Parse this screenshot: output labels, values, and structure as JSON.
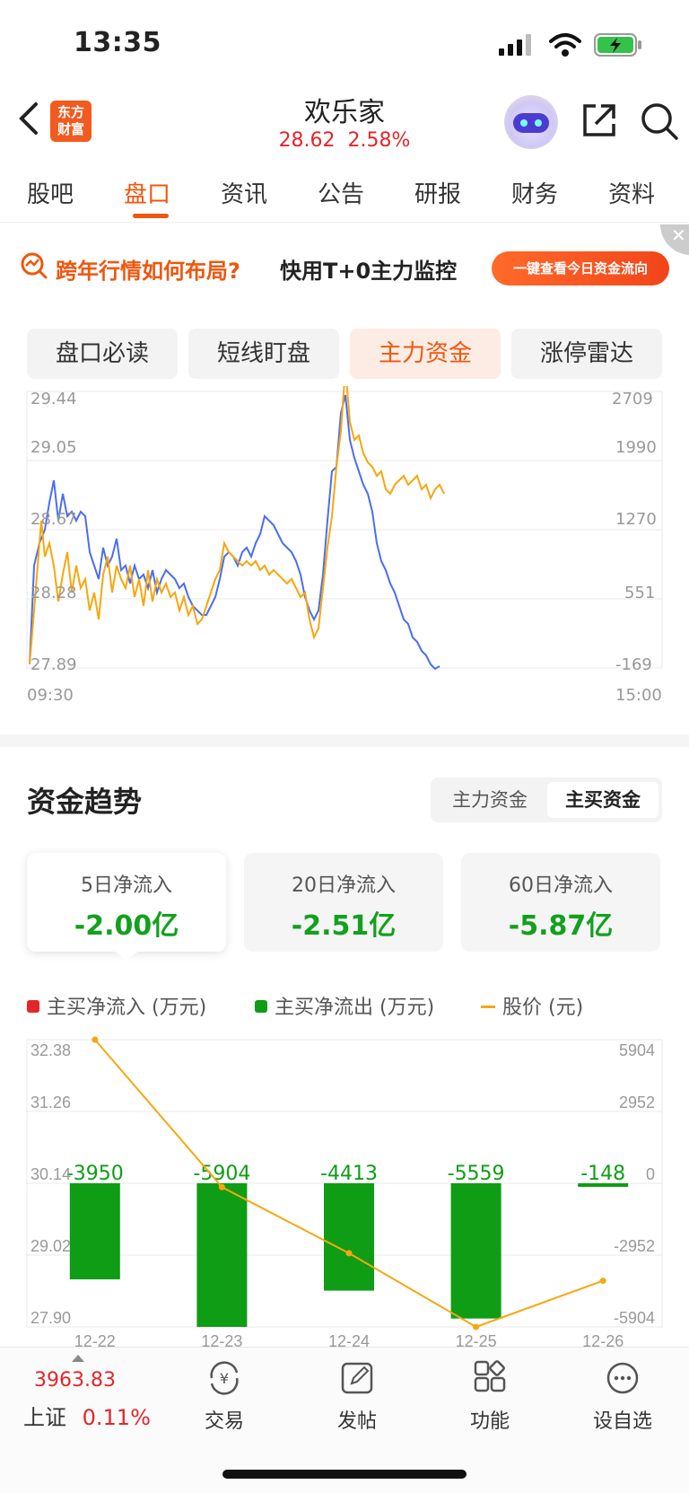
{
  "status_bar": {
    "time": "13:35"
  },
  "header": {
    "logo_line1": "东方",
    "logo_line2": "财富",
    "stock_name": "欢乐家",
    "price": "28.62",
    "change_pct": "2.58%"
  },
  "tabs": [
    "股吧",
    "盘口",
    "资讯",
    "公告",
    "研报",
    "财务",
    "资料"
  ],
  "active_tab": "盘口",
  "banner": {
    "text1": "跨年行情如何布局?",
    "text2": "快用T+0主力监控",
    "button": "一键查看今日资金流向",
    "close": "✕"
  },
  "segments": [
    "盘口必读",
    "短线盯盘",
    "主力资金",
    "涨停雷达"
  ],
  "active_segment": "主力资金",
  "intraday_chart": {
    "left_ticks": [
      "29.44",
      "29.05",
      "28.67",
      "28.28",
      "27.89"
    ],
    "right_ticks": [
      "2709",
      "1990",
      "1270",
      "551",
      "-169"
    ],
    "x_start": "09:30",
    "x_end": "15:00"
  },
  "fund_trend": {
    "title": "资金趋势",
    "toggle": [
      "主力资金",
      "主买资金"
    ],
    "active_toggle": "主买资金",
    "cards": [
      {
        "label": "5日净流入",
        "value": "-2.00亿"
      },
      {
        "label": "20日净流入",
        "value": "-2.51亿"
      },
      {
        "label": "60日净流入",
        "value": "-5.87亿"
      }
    ],
    "legend": {
      "inflow": "主买净流入 (万元)",
      "outflow": "主买净流出 (万元)",
      "price": "股价 (元)"
    }
  },
  "chart_data": {
    "type": "bar",
    "categories": [
      "12-22",
      "12-23",
      "12-24",
      "12-25",
      "12-26"
    ],
    "series": [
      {
        "name": "主买净流出 (万元)",
        "values": [
          -3950,
          -5904,
          -4413,
          -5559,
          -148
        ],
        "color": "#0f9d15"
      },
      {
        "name": "股价 (元)",
        "values": [
          32.38,
          30.08,
          29.05,
          27.9,
          28.62
        ],
        "color": "#f6a70f"
      }
    ],
    "left_ticks": [
      "32.38",
      "31.26",
      "30.14",
      "29.02",
      "27.90"
    ],
    "right_ticks": [
      "5904",
      "2952",
      "0",
      "-2952",
      "-5904"
    ],
    "ylim_left": [
      27.9,
      32.38
    ],
    "ylim_right": [
      -5904,
      5904
    ]
  },
  "bottom_bar": {
    "index_value": "3963.83",
    "index_name": "上证",
    "index_change": "0.11%",
    "items": [
      "交易",
      "发帖",
      "功能",
      "设自选"
    ]
  },
  "colors": {
    "accent": "#f0560e",
    "up": "#e5252a",
    "down": "#13a01e",
    "price_line": "#f6a70f",
    "flow_line": "#4a6ef0"
  }
}
